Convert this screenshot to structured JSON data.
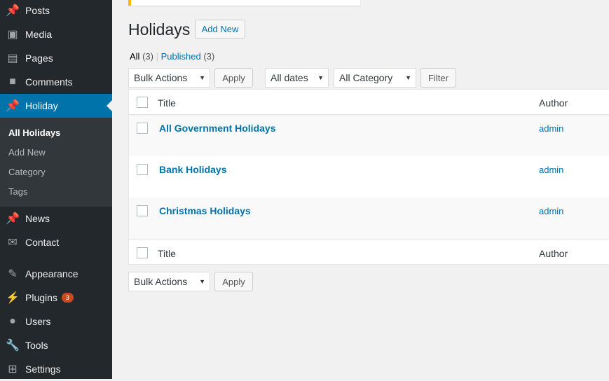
{
  "sidebar": {
    "items": [
      {
        "label": "Posts",
        "icon": "pin-icon"
      },
      {
        "label": "Media",
        "icon": "media-icon"
      },
      {
        "label": "Pages",
        "icon": "pages-icon"
      },
      {
        "label": "Comments",
        "icon": "comment-icon"
      },
      {
        "label": "Holiday",
        "icon": "pin-icon"
      },
      {
        "label": "News",
        "icon": "pin-icon"
      },
      {
        "label": "Contact",
        "icon": "mail-icon"
      },
      {
        "label": "Appearance",
        "icon": "brush-icon"
      },
      {
        "label": "Plugins",
        "icon": "plugin-icon",
        "badge": "3"
      },
      {
        "label": "Users",
        "icon": "user-icon"
      },
      {
        "label": "Tools",
        "icon": "wrench-icon"
      },
      {
        "label": "Settings",
        "icon": "settings-icon"
      }
    ],
    "submenu": [
      "All Holidays",
      "Add New",
      "Category",
      "Tags"
    ]
  },
  "page": {
    "title": "Holidays",
    "add_new": "Add New",
    "filters": {
      "all": "All",
      "all_count": "(3)",
      "sep": "|",
      "published": "Published",
      "published_count": "(3)"
    },
    "bulk_actions": "Bulk Actions",
    "apply": "Apply",
    "dates": "All dates",
    "category": "All Category",
    "filter": "Filter"
  },
  "table": {
    "headers": {
      "title": "Title",
      "author": "Author"
    },
    "rows": [
      {
        "title": "All Government Holidays",
        "author": "admin"
      },
      {
        "title": "Bank Holidays",
        "author": "admin"
      },
      {
        "title": "Christmas Holidays",
        "author": "admin"
      }
    ]
  }
}
